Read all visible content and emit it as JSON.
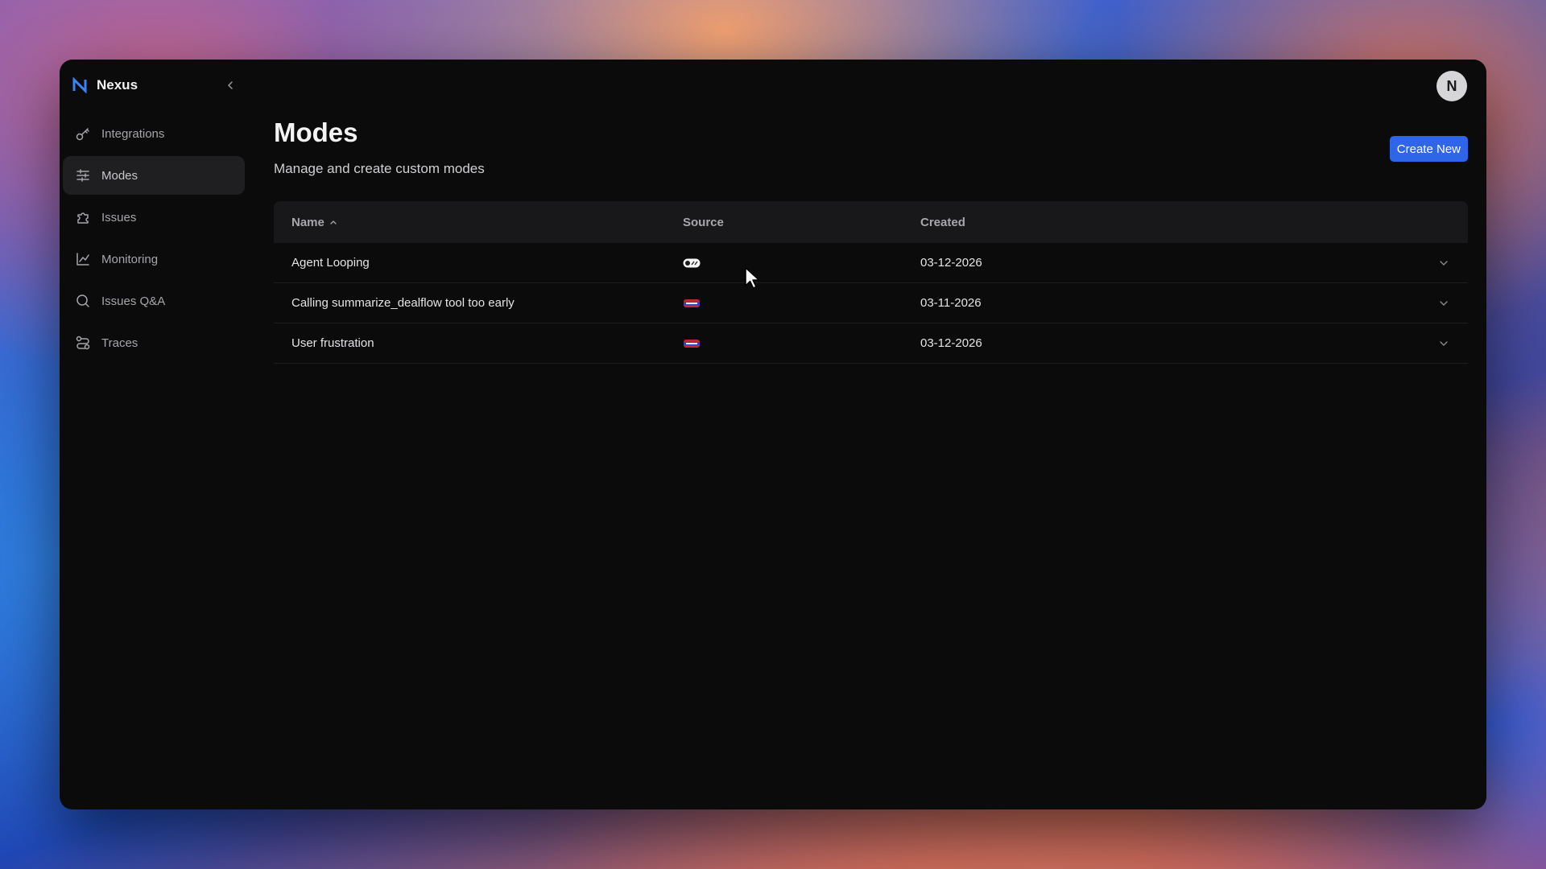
{
  "app": {
    "name": "Nexus",
    "avatar_initial": "N"
  },
  "sidebar": {
    "items": [
      {
        "label": "Integrations",
        "icon": "key-icon",
        "active": false
      },
      {
        "label": "Modes",
        "icon": "sliders-icon",
        "active": true
      },
      {
        "label": "Issues",
        "icon": "puzzle-icon",
        "active": false
      },
      {
        "label": "Monitoring",
        "icon": "line-chart-icon",
        "active": false
      },
      {
        "label": "Issues Q&A",
        "icon": "search-icon",
        "active": false
      },
      {
        "label": "Traces",
        "icon": "route-icon",
        "active": false
      }
    ]
  },
  "main": {
    "title": "Modes",
    "subtitle": "Manage and create custom modes",
    "create_button": "Create New"
  },
  "table": {
    "headers": {
      "name": "Name",
      "source": "Source",
      "created": "Created"
    },
    "sort": {
      "column": "name",
      "direction": "ascending"
    },
    "rows": [
      {
        "name": "Agent Looping",
        "source_icon": "toggle-badge-icon",
        "created": "03-12-2026"
      },
      {
        "name": "Calling summarize_dealflow tool too early",
        "source_icon": "flag-badge-icon",
        "created": "03-11-2026"
      },
      {
        "name": "User frustration",
        "source_icon": "flag-badge-icon",
        "created": "03-12-2026"
      }
    ]
  },
  "colors": {
    "accent": "#2f66e8",
    "window_bg": "#0b0b0c",
    "active_nav_bg": "#1f1f22",
    "header_bg": "#18181a",
    "brand_logo": "#3b82f6"
  }
}
